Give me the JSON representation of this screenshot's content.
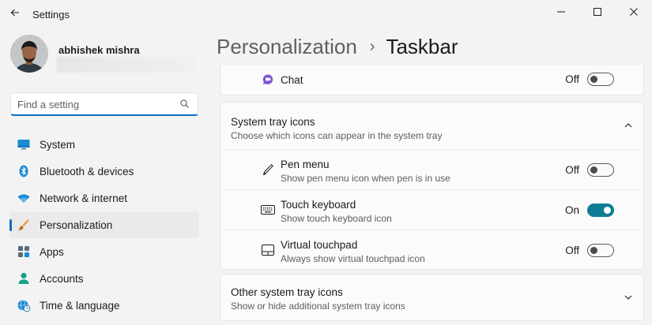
{
  "window": {
    "title": "Settings",
    "back_icon": "back-arrow-icon",
    "controls": [
      "minimize-icon",
      "maximize-icon",
      "close-icon"
    ]
  },
  "profile": {
    "name": "abhishek mishra"
  },
  "search": {
    "placeholder": "Find a setting",
    "icon": "search-icon"
  },
  "sidebar": {
    "items": [
      {
        "label": "System",
        "icon": "system-icon",
        "active": false
      },
      {
        "label": "Bluetooth & devices",
        "icon": "bluetooth-icon",
        "active": false
      },
      {
        "label": "Network & internet",
        "icon": "wifi-icon",
        "active": false
      },
      {
        "label": "Personalization",
        "icon": "brush-icon",
        "active": true
      },
      {
        "label": "Apps",
        "icon": "apps-icon",
        "active": false
      },
      {
        "label": "Accounts",
        "icon": "accounts-icon",
        "active": false
      },
      {
        "label": "Time & language",
        "icon": "globe-clock-icon",
        "active": false
      }
    ]
  },
  "breadcrumb": {
    "parent": "Personalization",
    "separator": "›",
    "current": "Taskbar"
  },
  "chat": {
    "label": "Chat",
    "icon": "chat-icon",
    "state": "Off"
  },
  "system_tray": {
    "title": "System tray icons",
    "subtitle": "Choose which icons can appear in the system tray",
    "expanded": true,
    "items": [
      {
        "label": "Pen menu",
        "description": "Show pen menu icon when pen is in use",
        "icon": "pen-icon",
        "state": "Off"
      },
      {
        "label": "Touch keyboard",
        "description": "Show touch keyboard icon",
        "icon": "keyboard-icon",
        "state": "On"
      },
      {
        "label": "Virtual touchpad",
        "description": "Always show virtual touchpad icon",
        "icon": "touchpad-icon",
        "state": "Off"
      }
    ]
  },
  "other_tray": {
    "title": "Other system tray icons",
    "subtitle": "Show or hide additional system tray icons",
    "expanded": false
  },
  "colors": {
    "accent": "#0f6cbd",
    "toggle_on": "#0f7c95",
    "background": "#f3f3f3",
    "card": "#fbfbfb"
  }
}
